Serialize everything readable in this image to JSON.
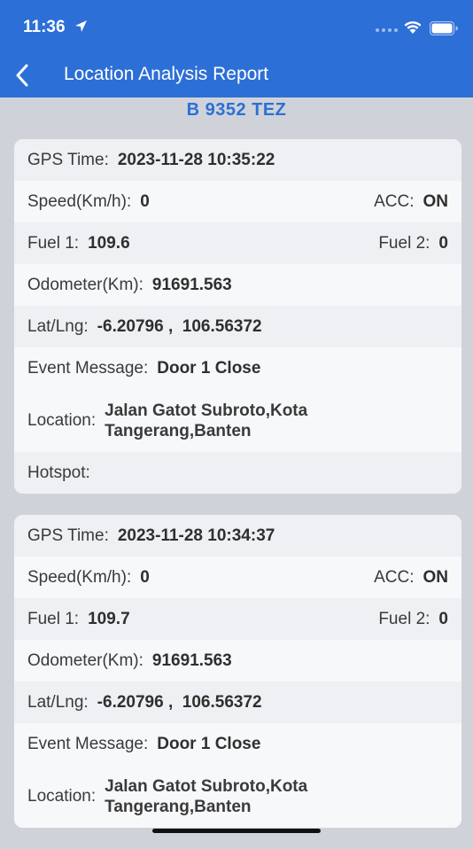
{
  "status_bar": {
    "time": "11:36"
  },
  "nav": {
    "title": "Location Analysis Report"
  },
  "plate": "B 9352 TEZ",
  "labels": {
    "gps_time": "GPS Time:",
    "speed": "Speed(Km/h):",
    "acc": "ACC:",
    "fuel1": "Fuel 1:",
    "fuel2": "Fuel 2:",
    "odometer": "Odometer(Km):",
    "latlng": "Lat/Lng:",
    "event": "Event Message:",
    "location": "Location:",
    "hotspot": "Hotspot:"
  },
  "records": [
    {
      "gps_time": "2023-11-28 10:35:22",
      "speed": "0",
      "acc": "ON",
      "fuel1": "109.6",
      "fuel2": "0",
      "odometer": "91691.563",
      "latlng": "-6.20796 ,  106.56372",
      "event": "Door 1 Close",
      "location_line1": "Jalan Gatot Subroto,Kota",
      "location_line2": "Tangerang,Banten",
      "hotspot": ""
    },
    {
      "gps_time": "2023-11-28 10:34:37",
      "speed": "0",
      "acc": "ON",
      "fuel1": "109.7",
      "fuel2": "0",
      "odometer": "91691.563",
      "latlng": "-6.20796 ,  106.56372",
      "event": "Door 1 Close",
      "location_line1": "Jalan Gatot Subroto,Kota",
      "location_line2": "Tangerang,Banten",
      "hotspot": ""
    }
  ],
  "colors": {
    "header": "#2c6fd6",
    "background": "#cfd3d9",
    "plate": "#2c6fd6"
  },
  "icons": [
    "location-arrow-icon",
    "wifi-icon",
    "battery-icon",
    "back-chevron-icon"
  ]
}
